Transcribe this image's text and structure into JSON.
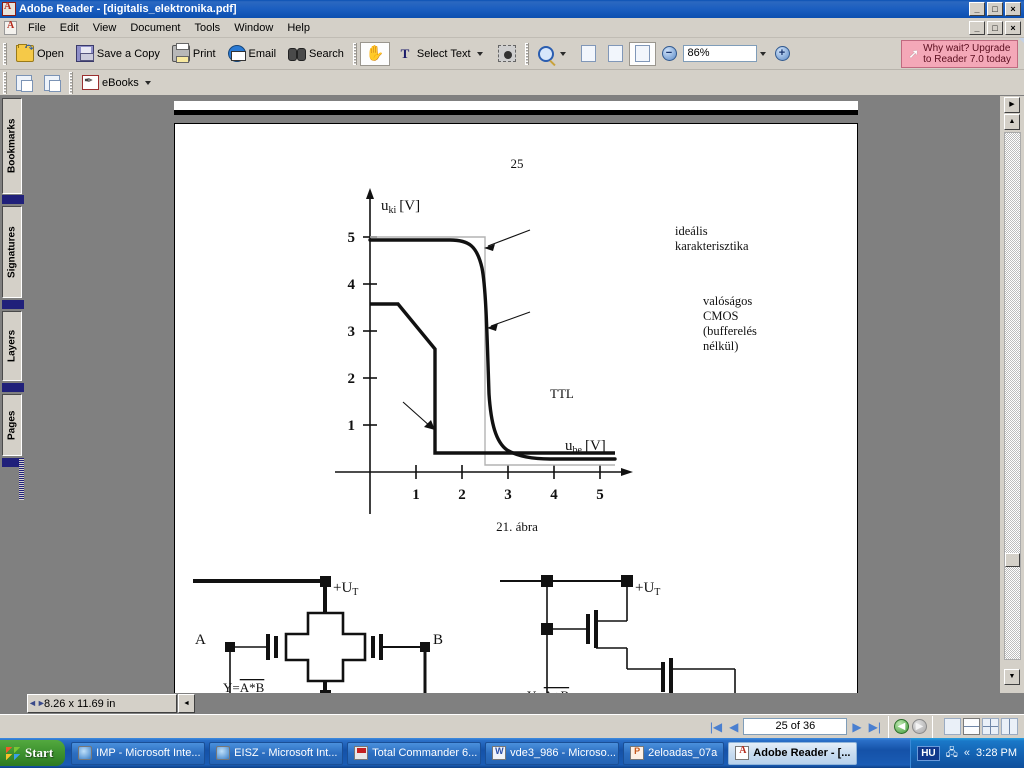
{
  "window": {
    "title": "Adobe Reader - [digitalis_elektronika.pdf]",
    "app_icon": "adobe-reader-icon",
    "minimize": "_",
    "maximize": "□",
    "close": "×"
  },
  "menu": {
    "items": [
      "File",
      "Edit",
      "View",
      "Document",
      "Tools",
      "Window",
      "Help"
    ]
  },
  "toolbar_main": {
    "buttons": [
      {
        "label": "Open",
        "icon": "open-folder-icon"
      },
      {
        "label": "Save a Copy",
        "icon": "floppy-disk-icon"
      },
      {
        "label": "Print",
        "icon": "printer-icon"
      },
      {
        "label": "Email",
        "icon": "email-globe-icon"
      },
      {
        "label": "Search",
        "icon": "binoculars-icon"
      }
    ],
    "hand_tool": "hand-icon",
    "select_text": "Select Text",
    "select_text_icon": "text-select-icon",
    "snapshot_icon": "snapshot-camera-icon",
    "zoom_tool_icon": "magnifier-icon",
    "page_view_icons": [
      "actual-size-icon",
      "fit-page-icon",
      "fit-width-icon"
    ],
    "zoom_out": "−",
    "zoom_value": "86%",
    "zoom_in": "+"
  },
  "upgrade_banner": {
    "line1": "Why wait? Upgrade",
    "line2": "to Reader 7.0 today",
    "icon": "arrow-cursor-icon",
    "bg_color": "#f4a8b8"
  },
  "toolbar_secondary": {
    "page_buttons": [
      "insert-page-icon",
      "extract-page-icon"
    ],
    "ebooks_label": "eBooks",
    "ebooks_icon": "ebooks-pen-icon"
  },
  "nav_tabs": {
    "items": [
      "Bookmarks",
      "Signatures",
      "Layers",
      "Pages"
    ]
  },
  "document": {
    "page_number_text": "25",
    "figure_caption": "21. ábra",
    "page_size": "8.26 x 11.69 in",
    "annotations": {
      "ideal": [
        "ideális",
        "karakterisztika"
      ],
      "real": [
        "valóságos",
        "CMOS",
        "(bufferelés",
        "nélkül)"
      ],
      "ttl": "TTL"
    },
    "circuit": {
      "supply_label": "+U",
      "supply_sub": "T",
      "input_a": "A",
      "input_b": "B",
      "output_nand": "Y=A*B",
      "output_nor": "Y=A+B"
    }
  },
  "chart_data": {
    "type": "line",
    "title": "",
    "xlabel": "u_be [V]",
    "xlabel_main": "u",
    "xlabel_sub": "be",
    "xlabel_unit": "[V]",
    "ylabel_main": "u",
    "ylabel_sub": "ki",
    "ylabel_unit": "[V]",
    "xlim": [
      0,
      5.6
    ],
    "ylim": [
      0,
      5.6
    ],
    "xticks": [
      1,
      2,
      3,
      4,
      5
    ],
    "yticks": [
      1,
      2,
      3,
      4,
      5
    ],
    "grid": false,
    "legend": "annotations",
    "series": [
      {
        "name": "ideális karakterisztika",
        "color": "#b0b0b0",
        "style": "thin",
        "points": [
          [
            0,
            5
          ],
          [
            2.5,
            5
          ],
          [
            2.5,
            0.15
          ],
          [
            5.2,
            0.15
          ]
        ]
      },
      {
        "name": "valóságos CMOS (bufferelés nélkül)",
        "color": "#000000",
        "style": "thick",
        "points": [
          [
            0,
            4.95
          ],
          [
            1.75,
            4.95
          ],
          [
            2.1,
            4.85
          ],
          [
            2.35,
            4.4
          ],
          [
            2.5,
            2.6
          ],
          [
            2.62,
            0.95
          ],
          [
            2.75,
            0.5
          ],
          [
            3.0,
            0.25
          ],
          [
            3.4,
            0.18
          ],
          [
            5.2,
            0.18
          ]
        ]
      },
      {
        "name": "TTL",
        "color": "#000000",
        "style": "thick",
        "points": [
          [
            0,
            3.5
          ],
          [
            0.62,
            3.5
          ],
          [
            1.35,
            2.55
          ],
          [
            1.35,
            0.35
          ],
          [
            5.2,
            0.35
          ]
        ]
      }
    ]
  },
  "statusbar": {
    "first_page_icon": "first-page-icon",
    "prev_page_icon": "previous-page-icon",
    "page_value": "25 of 36",
    "next_page_icon": "next-page-icon",
    "last_page_icon": "last-page-icon",
    "back_icon": "go-back-icon",
    "forward_icon": "go-forward-icon",
    "view_modes": [
      "single-page-icon",
      "continuous-icon",
      "facing-icon",
      "continuous-facing-icon"
    ]
  },
  "taskbar": {
    "start_label": "Start",
    "items": [
      {
        "label": "IMP - Microsoft Inte...",
        "icon": "ie",
        "active": false
      },
      {
        "label": "EISZ - Microsoft Int...",
        "icon": "ie",
        "active": false
      },
      {
        "label": "Total Commander 6...",
        "icon": "tc",
        "active": false
      },
      {
        "label": "vde3_986 - Microso...",
        "icon": "word",
        "active": false
      },
      {
        "label": "2eloadas_07a",
        "icon": "ppt",
        "active": false
      },
      {
        "label": "Adobe Reader - [...",
        "icon": "pdf",
        "active": true
      }
    ],
    "language": "HU",
    "tray_icons": [
      "network-icon",
      "show-hidden-icon"
    ],
    "clock": "3:28 PM"
  }
}
